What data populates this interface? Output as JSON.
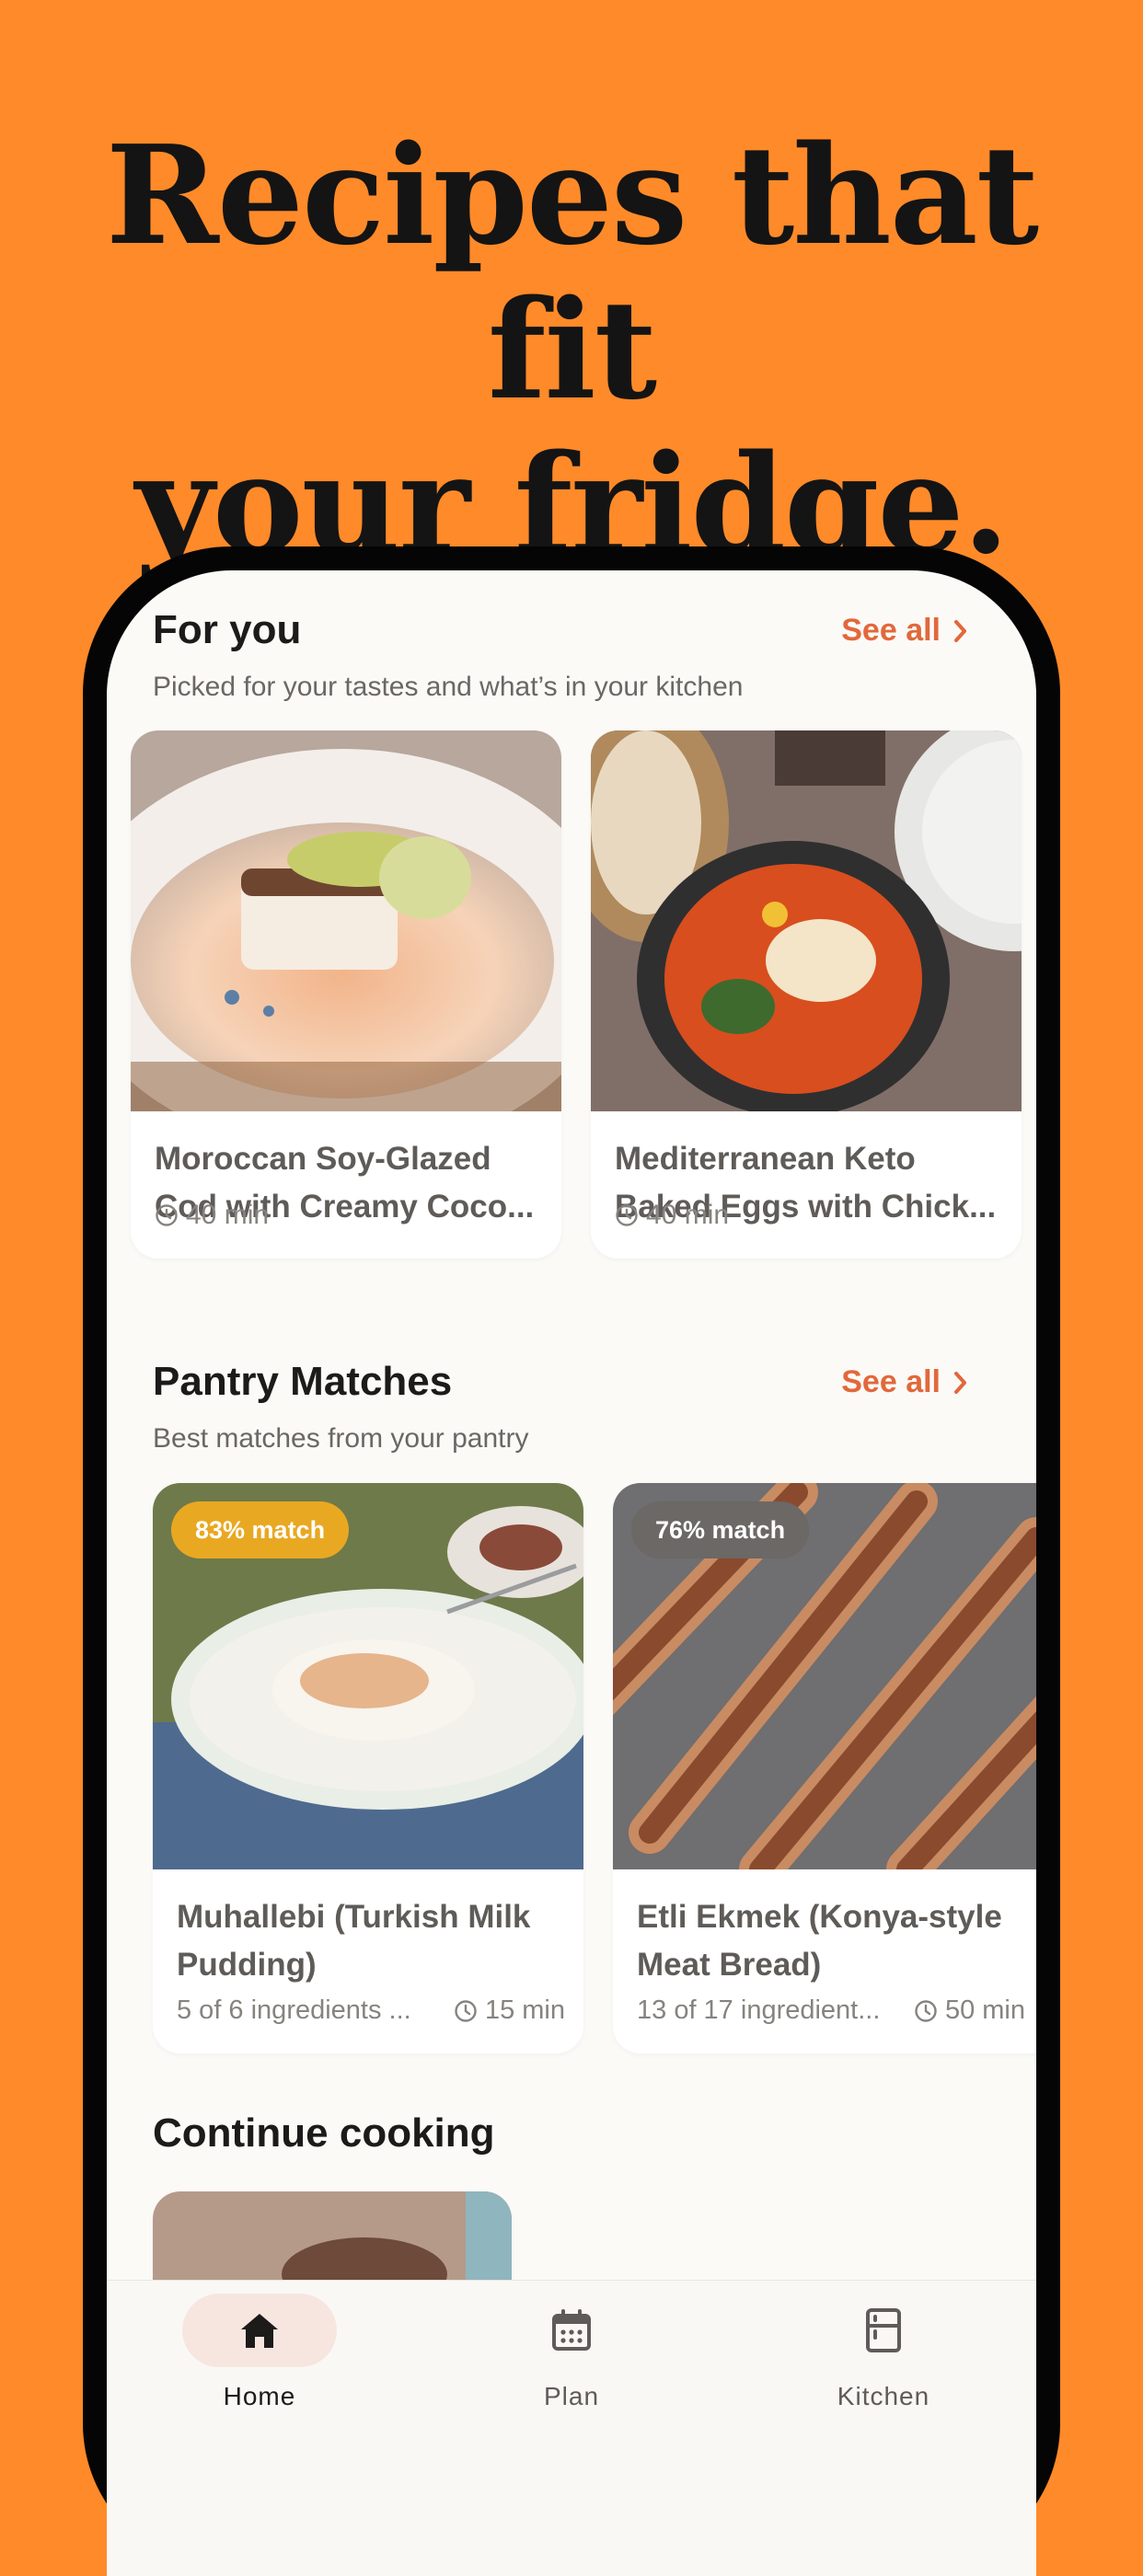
{
  "headline": {
    "line1": "Recipes that fit",
    "line2": "your fridge."
  },
  "for_you": {
    "title": "For you",
    "subtitle": "Picked for your tastes and what’s in your kitchen",
    "see_all": "See all",
    "cards": [
      {
        "name": "Moroccan Soy-Glazed\nCod with Creamy Coco...",
        "time": "40 min"
      },
      {
        "name": "Mediterranean Keto\nBaked Eggs with Chick...",
        "time": "40 min"
      }
    ]
  },
  "pantry": {
    "title": "Pantry Matches",
    "subtitle": "Best matches from your pantry",
    "see_all": "See all",
    "cards": [
      {
        "badge": "83% match",
        "badge_color": "#E9A822",
        "name": "Muhallebi (Turkish Milk\nPudding)",
        "ingredients": "5 of 6 ingredients ...",
        "time": "15 min"
      },
      {
        "badge": "76% match",
        "badge_color": "#6B6866",
        "name": "Etli Ekmek (Konya-style\nMeat Bread)",
        "ingredients": "13 of 17 ingredient...",
        "time": "50 min"
      }
    ]
  },
  "continue": {
    "title": "Continue cooking"
  },
  "tabs": [
    {
      "label": "Home",
      "icon": "home-icon",
      "active": true
    },
    {
      "label": "Plan",
      "icon": "calendar-icon",
      "active": false
    },
    {
      "label": "Kitchen",
      "icon": "fridge-icon",
      "active": false
    }
  ],
  "colors": {
    "background": "#FF8A29",
    "accent": "#E2683A",
    "active_tab_pill": "#F7E6E0"
  }
}
